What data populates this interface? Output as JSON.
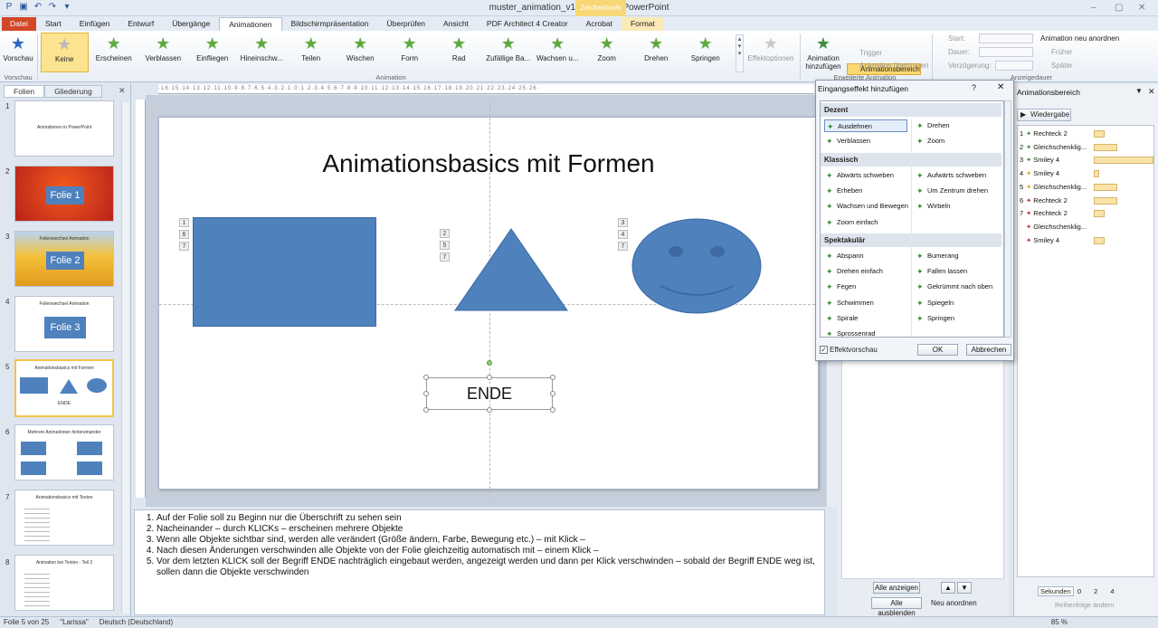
{
  "window": {
    "title": "muster_animation_v1 - Microsoft PowerPoint",
    "context_tab_group": "Zeichentools"
  },
  "tabs": [
    "Datei",
    "Start",
    "Einfügen",
    "Entwurf",
    "Übergänge",
    "Animationen",
    "Bildschirmpräsentation",
    "Überprüfen",
    "Ansicht",
    "PDF Architect 4 Creator",
    "Acrobat",
    "Format"
  ],
  "ribbon": {
    "preview_label": "Vorschau",
    "preview_group": "Vorschau",
    "animations": [
      "Keine",
      "Erscheinen",
      "Verblassen",
      "Einfliegen",
      "Hineinschw...",
      "Teilen",
      "Wischen",
      "Form",
      "Rad",
      "Zufällige Ba...",
      "Wachsen u...",
      "Zoom",
      "Drehen",
      "Springen"
    ],
    "animations_group": "Animation",
    "effect_options": "Effektoptionen",
    "add_animation": "Animation hinzufügen",
    "animation_pane": "Animationsbereich",
    "trigger": "Trigger",
    "transfer": "Animation übertragen",
    "advanced_group": "Erweiterte Animation",
    "start_label": "Start:",
    "duration_label": "Dauer:",
    "delay_label": "Verzögerung:",
    "timing_group": "Anzeigedauer",
    "reorder": "Animation neu anordnen",
    "earlier": "Früher",
    "later": "Später"
  },
  "left_panel": {
    "tab_slides": "Folien",
    "tab_outline": "Gliederung",
    "slides": [
      {
        "num": "1",
        "title": "Animationen in PowerPoint"
      },
      {
        "num": "2",
        "title": "Folie 1"
      },
      {
        "num": "3",
        "title": "Folie 2",
        "subtitle": "Folienwechsel Animation"
      },
      {
        "num": "4",
        "title": "Folie 3",
        "subtitle": "Folienwechsel Animation"
      },
      {
        "num": "5",
        "title": "Animationsbasics mit Formen",
        "end": "ENDE"
      },
      {
        "num": "6",
        "title": "Mehrere Animationen hintereinander"
      },
      {
        "num": "7",
        "title": "Animationsbasics mit Texten"
      },
      {
        "num": "8",
        "title": "Animation bei Texten - Teil 2"
      }
    ]
  },
  "slide": {
    "title": "Animationsbasics mit Formen",
    "end_label": "ENDE",
    "rect_tags": [
      "1",
      "6",
      "7"
    ],
    "tri_tags": [
      "2",
      "5",
      "7"
    ],
    "smiley_tags": [
      "3",
      "4",
      "7"
    ]
  },
  "notes": [
    "Auf der Folie soll zu Beginn nur die Überschrift zu sehen sein",
    "Nacheinander – durch KLICKs – erscheinen mehrere Objekte",
    "Wenn alle Objekte sichtbar sind, werden alle verändert (Größe ändern, Farbe, Bewegung etc.) – mit Klick –",
    "Nach diesen Änderungen verschwinden alle Objekte von der Folie gleichzeitig automatisch mit – einem Klick –",
    "Vor dem letzten KLICK soll der Begriff ENDE nachträglich eingebaut werden, angezeigt werden und dann per Klick verschwinden – sobald der Begriff ENDE weg ist, sollen dann die Objekte verschwinden"
  ],
  "status": {
    "slide": "Folie 5 von 25",
    "theme": "\"Larissa\"",
    "language": "Deutsch (Deutschland)",
    "zoom": "85 %"
  },
  "dialog": {
    "title": "Eingangseffekt hinzufügen",
    "help": "?",
    "categories": [
      {
        "name": "Dezent",
        "effects": [
          "Ausdehnen",
          "Drehen",
          "Verblassen",
          "Zoom"
        ]
      },
      {
        "name": "Klassisch",
        "effects": [
          "Abwärts schweben",
          "Aufwärts schweben",
          "Erheben",
          "Um Zentrum drehen",
          "Wachsen und Bewegen",
          "Wirbeln",
          "Zoom einfach"
        ]
      },
      {
        "name": "Spektakulär",
        "effects": [
          "Abspann",
          "Bumerang",
          "Drehen einfach",
          "Fallen lassen",
          "Fegen",
          "Gekrümmt nach oben",
          "Schwimmen",
          "Spiegeln",
          "Spirale",
          "Springen",
          "Sprossenrad"
        ]
      }
    ],
    "selected_effect": "Ausdehnen",
    "preview_checkbox": "Effektvorschau",
    "ok": "OK",
    "cancel": "Abbrechen"
  },
  "middle_pane": {
    "show_all": "Alle anzeigen",
    "hide_all": "Alle ausblenden",
    "reorder": "Neu anordnen"
  },
  "animation_pane": {
    "title": "Animationsbereich",
    "play": "Wiedergabe",
    "items": [
      {
        "n": "1",
        "name": "Rechteck 2"
      },
      {
        "n": "2",
        "name": "Gleichschenklig..."
      },
      {
        "n": "3",
        "name": "Smiley 4"
      },
      {
        "n": "4",
        "name": "Smiley 4"
      },
      {
        "n": "5",
        "name": "Gleichschenklig..."
      },
      {
        "n": "6",
        "name": "Rechteck 2"
      },
      {
        "n": "7",
        "name": "Rechteck 2"
      },
      {
        "n": "",
        "name": "Gleichschenklig..."
      },
      {
        "n": "",
        "name": "Smiley 4"
      }
    ],
    "seconds": "Sekunden",
    "timeline_ticks": [
      "0",
      "2",
      "4"
    ],
    "reorder": "Reihenfolge ändern"
  }
}
